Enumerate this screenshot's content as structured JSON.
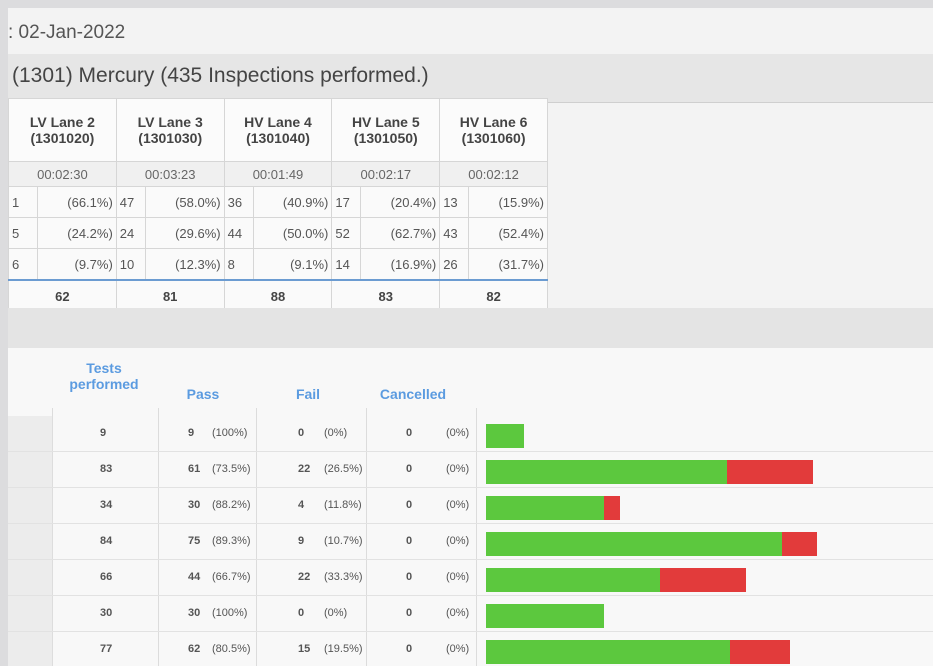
{
  "header": {
    "date": ": 02-Jan-2022",
    "station": "(1301) Mercury (435 Inspections performed.)"
  },
  "lanes": [
    {
      "name": "LV Lane 2",
      "code": "(1301020)",
      "time": "00:02:30",
      "rows": [
        [
          "1",
          "(66.1%)"
        ],
        [
          "5",
          "(24.2%)"
        ],
        [
          "6",
          "(9.7%)"
        ]
      ],
      "total": "62"
    },
    {
      "name": "LV Lane 3",
      "code": "(1301030)",
      "time": "00:03:23",
      "rows": [
        [
          "47",
          "(58.0%)"
        ],
        [
          "24",
          "(29.6%)"
        ],
        [
          "10",
          "(12.3%)"
        ]
      ],
      "total": "81"
    },
    {
      "name": "HV Lane 4",
      "code": "(1301040)",
      "time": "00:01:49",
      "rows": [
        [
          "36",
          "(40.9%)"
        ],
        [
          "44",
          "(50.0%)"
        ],
        [
          "8",
          "(9.1%)"
        ]
      ],
      "total": "88"
    },
    {
      "name": "HV Lane 5",
      "code": "(1301050)",
      "time": "00:02:17",
      "rows": [
        [
          "17",
          "(20.4%)"
        ],
        [
          "52",
          "(62.7%)"
        ],
        [
          "14",
          "(16.9%)"
        ]
      ],
      "total": "83"
    },
    {
      "name": "HV Lane 6",
      "code": "(1301060)",
      "time": "00:02:12",
      "rows": [
        [
          "13",
          "(15.9%)"
        ],
        [
          "43",
          "(52.4%)"
        ],
        [
          "26",
          "(31.7%)"
        ]
      ],
      "total": "82"
    }
  ],
  "stats": {
    "headers": {
      "tests_line1": "Tests",
      "tests_line2": "performed",
      "pass": "Pass",
      "fail": "Fail",
      "cancelled": "Cancelled"
    },
    "rows": [
      {
        "tests": "9",
        "pass": "9",
        "pass_pct": "(100%)",
        "fail": "0",
        "fail_pct": "(0%)",
        "canc": "0",
        "canc_pct": "(0%)",
        "pass_frac": 1.0,
        "fail_frac": 0.0
      },
      {
        "tests": "83",
        "pass": "61",
        "pass_pct": "(73.5%)",
        "fail": "22",
        "fail_pct": "(26.5%)",
        "canc": "0",
        "canc_pct": "(0%)",
        "pass_frac": 0.735,
        "fail_frac": 0.265
      },
      {
        "tests": "34",
        "pass": "30",
        "pass_pct": "(88.2%)",
        "fail": "4",
        "fail_pct": "(11.8%)",
        "canc": "0",
        "canc_pct": "(0%)",
        "pass_frac": 0.882,
        "fail_frac": 0.118
      },
      {
        "tests": "84",
        "pass": "75",
        "pass_pct": "(89.3%)",
        "fail": "9",
        "fail_pct": "(10.7%)",
        "canc": "0",
        "canc_pct": "(0%)",
        "pass_frac": 0.893,
        "fail_frac": 0.107
      },
      {
        "tests": "66",
        "pass": "44",
        "pass_pct": "(66.7%)",
        "fail": "22",
        "fail_pct": "(33.3%)",
        "canc": "0",
        "canc_pct": "(0%)",
        "pass_frac": 0.667,
        "fail_frac": 0.333
      },
      {
        "tests": "30",
        "pass": "30",
        "pass_pct": "(100%)",
        "fail": "0",
        "fail_pct": "(0%)",
        "canc": "0",
        "canc_pct": "(0%)",
        "pass_frac": 1.0,
        "fail_frac": 0.0
      },
      {
        "tests": "77",
        "pass": "62",
        "pass_pct": "(80.5%)",
        "fail": "15",
        "fail_pct": "(19.5%)",
        "canc": "0",
        "canc_pct": "(0%)",
        "pass_frac": 0.805,
        "fail_frac": 0.195
      }
    ],
    "colors": {
      "pass": "#5cc83e",
      "fail": "#e23b3b"
    }
  }
}
